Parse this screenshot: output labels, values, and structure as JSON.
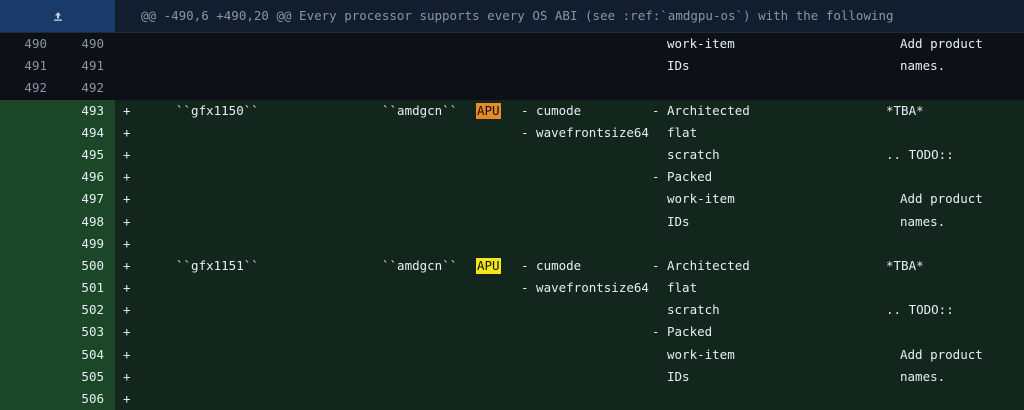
{
  "hunk": {
    "header": "@@ -490,6 +490,20 @@ Every processor supports every OS ABI (see :ref:`amdgpu-os`) with the following",
    "expand_icon": "expand-up-icon"
  },
  "colors": {
    "apu_badge_1": "#e8892a",
    "apu_badge_2": "#f5e51b",
    "add_bg": "#12261e",
    "add_gutter": "#1b4728",
    "hunk_bg": "#121d2f"
  },
  "context_lines": [
    {
      "old": "490",
      "new": "490",
      "abi": "work-item",
      "prod2": "Add product"
    },
    {
      "old": "491",
      "new": "491",
      "abi": "IDs",
      "prod2": "names."
    },
    {
      "old": "492",
      "new": "492"
    }
  ],
  "added_lines": [
    {
      "new": "493",
      "sign": "+",
      "proc": "``gfx1150``",
      "tgt": "``amdgcn``",
      "badge": "APU",
      "feat": "- cumode",
      "dash": "-",
      "abi": "Architected",
      "prod": "*TBA*"
    },
    {
      "new": "494",
      "sign": "+",
      "feat": "- wavefrontsize64",
      "abi": "flat"
    },
    {
      "new": "495",
      "sign": "+",
      "abi": "scratch",
      "prod": ".. TODO::"
    },
    {
      "new": "496",
      "sign": "+",
      "dash": "-",
      "abi": "Packed"
    },
    {
      "new": "497",
      "sign": "+",
      "abi": "work-item",
      "prod2": "Add product"
    },
    {
      "new": "498",
      "sign": "+",
      "abi": "IDs",
      "prod2": "names."
    },
    {
      "new": "499",
      "sign": "+"
    },
    {
      "new": "500",
      "sign": "+",
      "proc": "``gfx1151``",
      "tgt": "``amdgcn``",
      "badge": "APU",
      "feat": "- cumode",
      "dash": "-",
      "abi": "Architected",
      "prod": "*TBA*"
    },
    {
      "new": "501",
      "sign": "+",
      "feat": "- wavefrontsize64",
      "abi": "flat"
    },
    {
      "new": "502",
      "sign": "+",
      "abi": "scratch",
      "prod": ".. TODO::"
    },
    {
      "new": "503",
      "sign": "+",
      "dash": "-",
      "abi": "Packed"
    },
    {
      "new": "504",
      "sign": "+",
      "abi": "work-item",
      "prod2": "Add product"
    },
    {
      "new": "505",
      "sign": "+",
      "abi": "IDs",
      "prod2": "names."
    },
    {
      "new": "506",
      "sign": "+"
    }
  ]
}
